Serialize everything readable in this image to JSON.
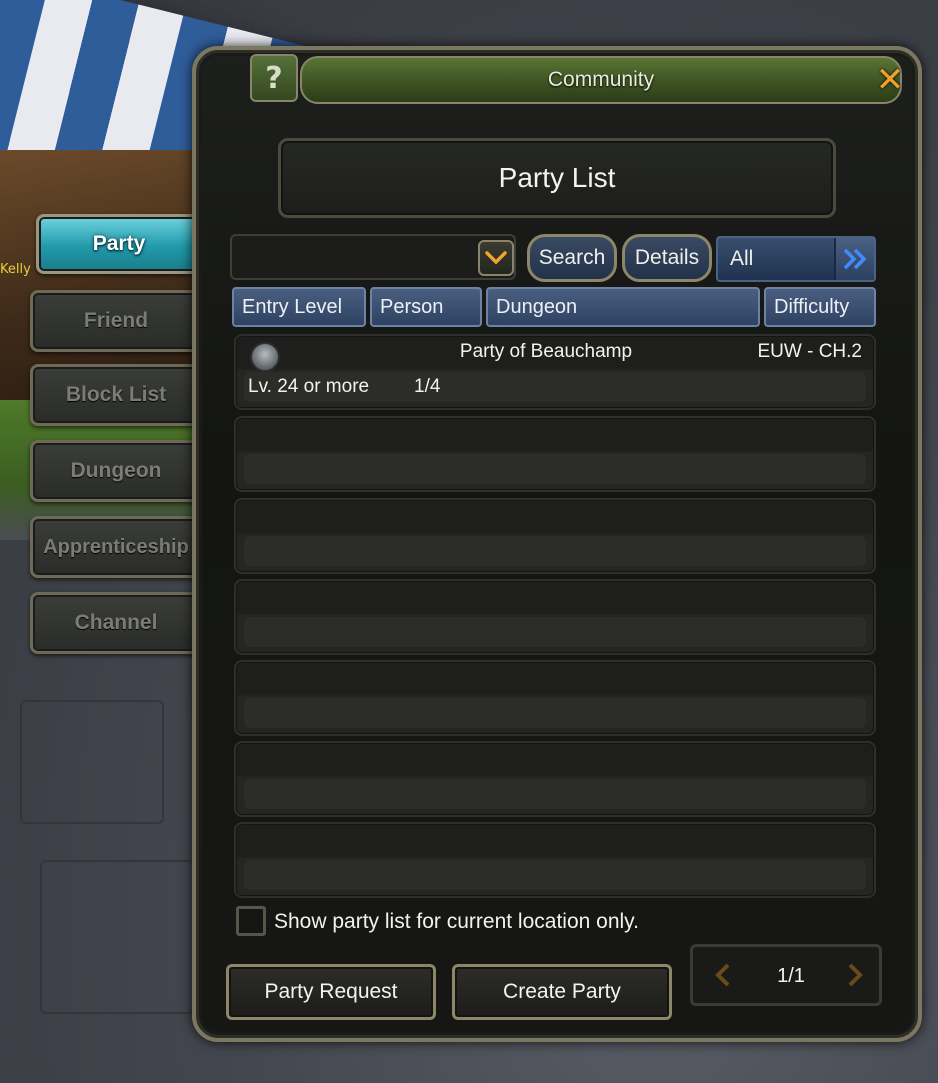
{
  "background": {
    "name_tag": "Kelly"
  },
  "window": {
    "title": "Community",
    "help_label": "?",
    "close_label": "✕",
    "subtitle": "Party List"
  },
  "sidebar": {
    "items": [
      {
        "label": "Party",
        "active": true
      },
      {
        "label": "Friend",
        "active": false
      },
      {
        "label": "Block List",
        "active": false
      },
      {
        "label": "Dungeon",
        "active": false
      },
      {
        "label": "Apprenticeship",
        "active": false
      },
      {
        "label": "Channel",
        "active": false
      }
    ]
  },
  "filter": {
    "search_value": "",
    "search_label": "Search",
    "details_label": "Details",
    "scope_selected": "All"
  },
  "table": {
    "columns": [
      "Entry Level",
      "Person",
      "Dungeon",
      "Difficulty"
    ],
    "rows": [
      {
        "name": "Party of Beauchamp",
        "difficulty": "EUW - CH.2",
        "entry_level": "Lv. 24 or more",
        "persons": "1/4"
      }
    ]
  },
  "footer": {
    "checkbox_label": "Show party list for current location only.",
    "checkbox_checked": false,
    "party_request_label": "Party Request",
    "create_party_label": "Create Party",
    "page_indicator": "1/1"
  },
  "colors": {
    "active_tab": "#219aab",
    "title_green": "#3d5423",
    "header_blue": "#2e4262",
    "close_orange": "#f2a02a"
  }
}
